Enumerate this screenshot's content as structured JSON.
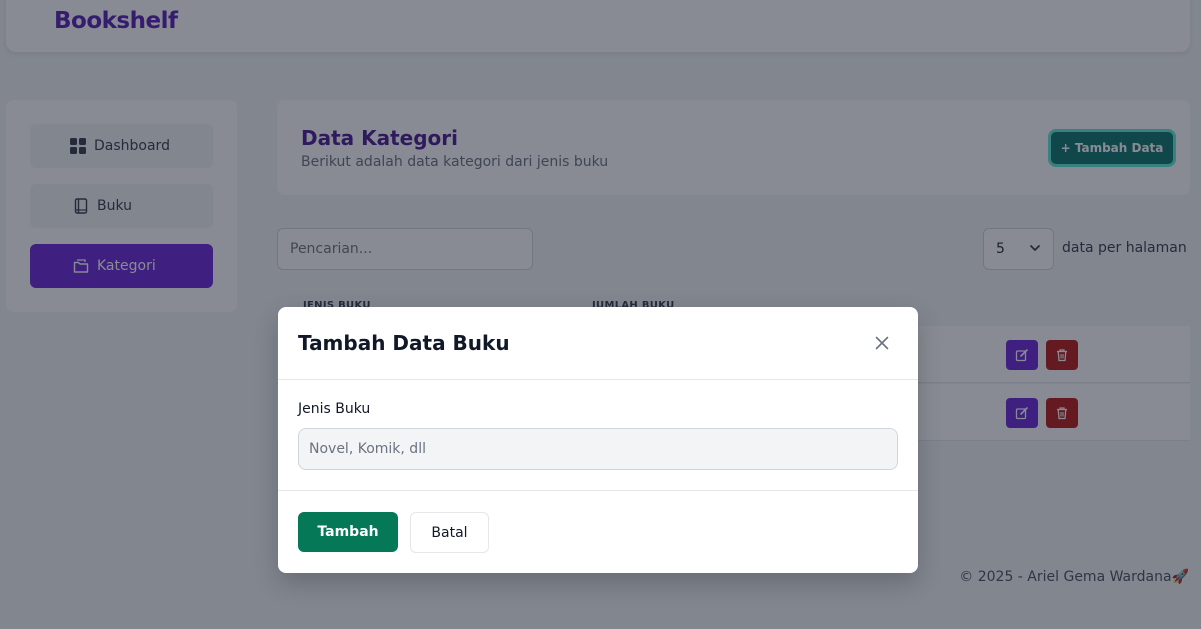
{
  "app": {
    "brand": "Bookshelf"
  },
  "sidebar": {
    "items": [
      {
        "label": "Dashboard",
        "icon": "grid-icon",
        "active": false
      },
      {
        "label": "Buku",
        "icon": "book-icon",
        "active": false
      },
      {
        "label": "Kategori",
        "icon": "folder-icon",
        "active": true
      }
    ]
  },
  "header": {
    "title": "Data Kategori",
    "subtitle": "Berikut adalah data kategori dari jenis buku",
    "add_label": "+ Tambah Data"
  },
  "toolbar": {
    "search_placeholder": "Pencarian...",
    "per_page_value": "5",
    "per_page_label": "data per halaman"
  },
  "table": {
    "columns": [
      "JENIS BUKU",
      "JUMLAH BUKU"
    ]
  },
  "footer": {
    "text": "© 2025 - Ariel Gema Wardana🚀"
  },
  "modal": {
    "title": "Tambah Data Buku",
    "field_label": "Jenis Buku",
    "field_placeholder": "Novel, Komik, dll",
    "submit_label": "Tambah",
    "cancel_label": "Batal"
  },
  "colors": {
    "brand": "#5b21b6",
    "active": "#6d28d9",
    "primary_green": "#047857",
    "danger": "#b91c1c"
  }
}
